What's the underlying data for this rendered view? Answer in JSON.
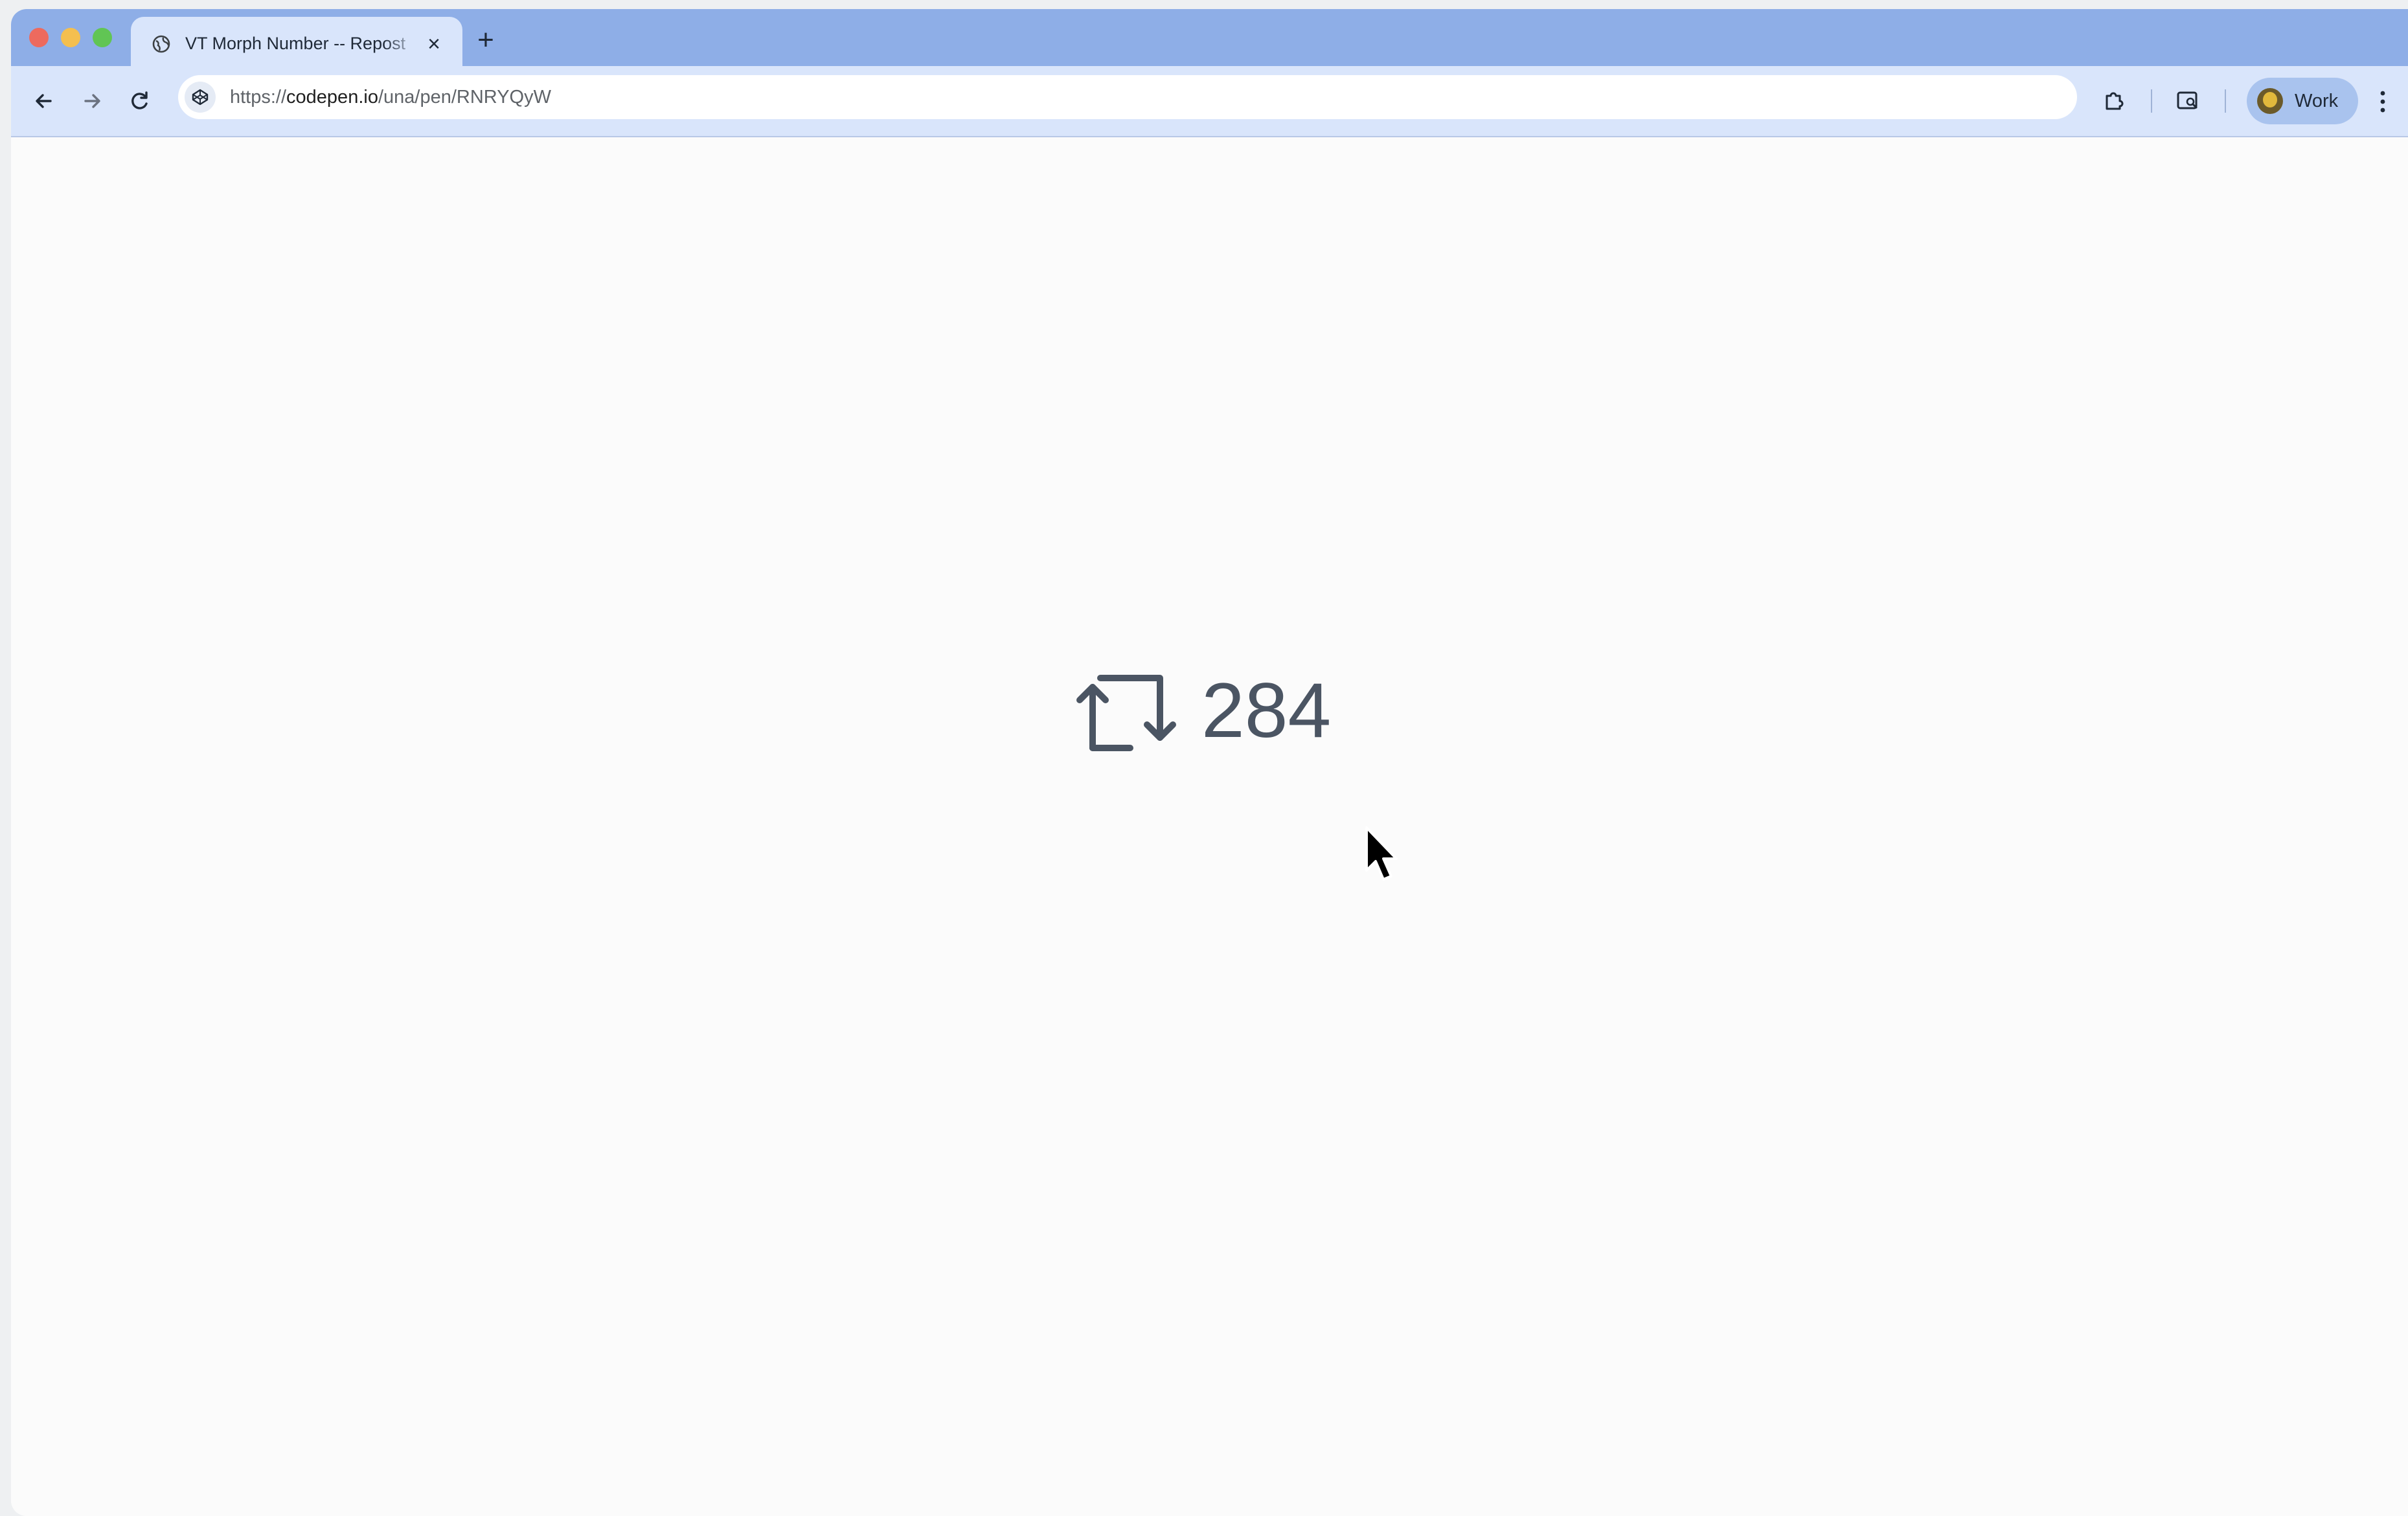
{
  "browser": {
    "tab": {
      "title": "VT Morph Number -- Repost",
      "close_glyph": "×"
    },
    "new_tab_glyph": "+",
    "address_bar": {
      "scheme": "https://",
      "host": "codepen.io",
      "path": "/una/pen/RNRYQyW"
    },
    "profile": {
      "label": "Work"
    },
    "accent_color": "#8eaee7"
  },
  "page": {
    "repost": {
      "icon": "repost-icon",
      "count": "284",
      "color": "#4b5563"
    }
  }
}
